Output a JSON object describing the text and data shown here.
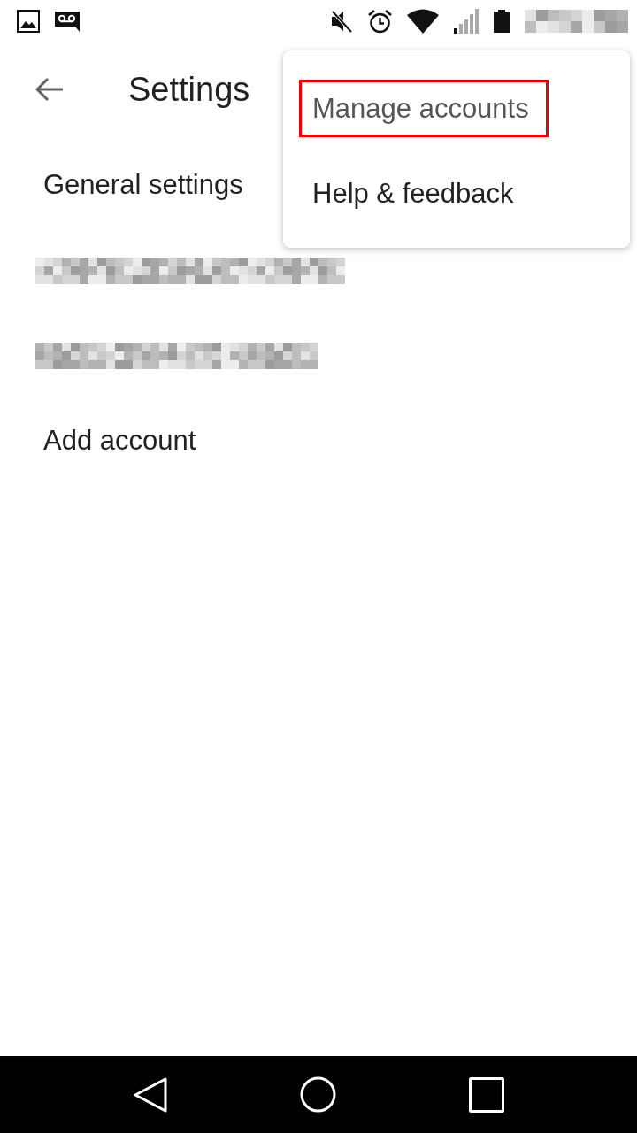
{
  "status_bar": {
    "clock": {
      "kind": "redacted"
    }
  },
  "header": {
    "title": "Settings"
  },
  "list": [
    {
      "kind": "text",
      "label": "General settings"
    },
    {
      "kind": "redacted"
    },
    {
      "kind": "redacted"
    },
    {
      "kind": "text",
      "label": "Add account"
    }
  ],
  "menu": {
    "items": [
      {
        "label": "Manage accounts",
        "highlighted": true
      },
      {
        "label": "Help & feedback",
        "highlighted": false
      }
    ]
  }
}
